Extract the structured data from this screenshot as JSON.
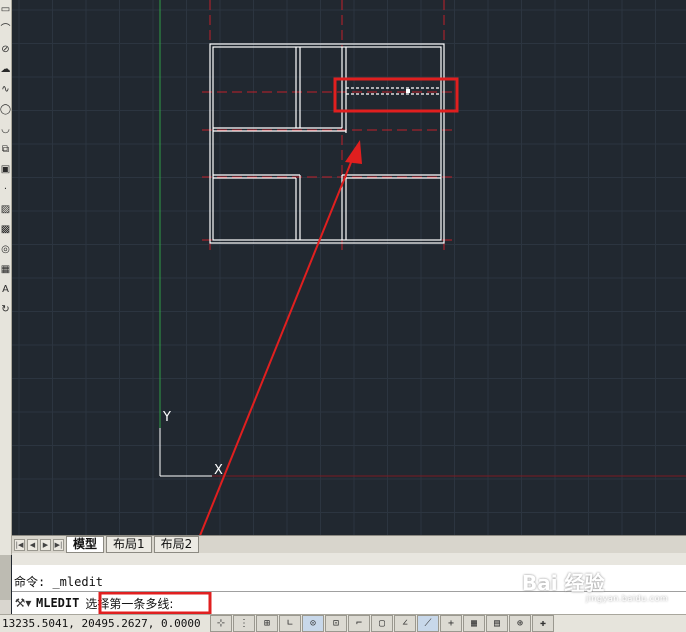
{
  "toolbar": {
    "icons": [
      "rectangle-icon",
      "arc-icon",
      "circle-icon",
      "revcloud-icon",
      "spline-icon",
      "ellipse-icon",
      "ellipse-arc-icon",
      "insert-block-icon",
      "make-block-icon",
      "point-icon",
      "hatch-icon",
      "gradient-icon",
      "region-icon",
      "table-icon",
      "multiline-text-icon",
      "add-selected-icon"
    ],
    "glyphs": [
      "▭",
      "⌒",
      "⊘",
      "☁",
      "∿",
      "◯",
      "◡",
      "⧉",
      "▣",
      "·",
      "▨",
      "▩",
      "◎",
      "▦",
      "A",
      "↻"
    ]
  },
  "tabs": {
    "model": "模型",
    "layout1": "布局1",
    "layout2": "布局2"
  },
  "command": {
    "history": "命令:  _mledit",
    "name": "MLEDIT",
    "prompt": "选择第一条多线:"
  },
  "status": {
    "coordinates": "13235.5041, 20495.2627, 0.0000",
    "buttons": [
      "snap",
      "grid",
      "ortho",
      "polar",
      "osnap",
      "3dosnap",
      "otrack",
      "ducs",
      "dyn",
      "lwt",
      "tpy",
      "qp",
      "sc",
      "am",
      "model"
    ],
    "glyphs": [
      "⊹",
      "⋮",
      "⊞",
      "∟",
      "⊙",
      "⊡",
      "⌐",
      "▢",
      "∠",
      "⟋",
      "+",
      "▦",
      "▤",
      "⊕",
      "✚"
    ]
  },
  "watermark": {
    "brand": "Bai 经验",
    "url": "jingyan.baidu.com"
  },
  "ucs": {
    "y_label": "Y",
    "x_label": "X"
  },
  "colors": {
    "canvas": "#212830",
    "grid": "#2c3540",
    "wall": "#ffffff",
    "centerline": "#c0202a",
    "annotation": "#e01f1f",
    "y_axis": "#2f9d46"
  }
}
